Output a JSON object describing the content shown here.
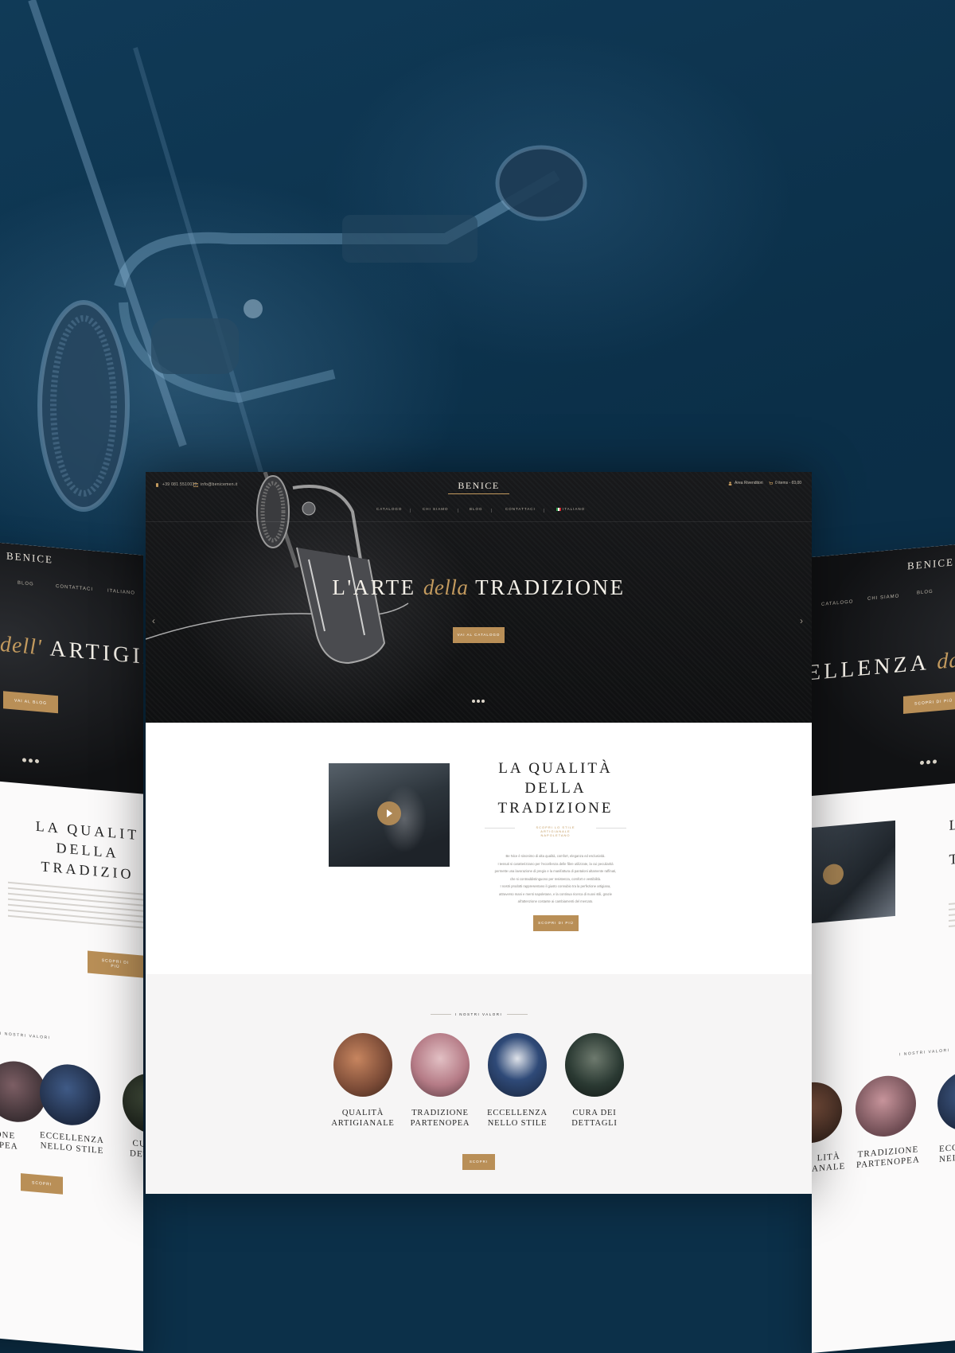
{
  "main": {
    "topbar": {
      "phone": "+39 081 5510033",
      "email": "info@benicemen.it",
      "logo": "BENICE",
      "reseller_area": "Area Rivenditori",
      "cart": "0 items - €0,00"
    },
    "nav": [
      "CATALOGO",
      "CHI SIAMO",
      "BLOG",
      "CONTATTACI",
      "ITALIANO"
    ],
    "hero": {
      "title_a": "L'ARTE",
      "title_b": "della",
      "title_c": "TRADIZIONE",
      "button": "VAI AL CATALOGO",
      "prev_arrow": "‹",
      "next_arrow": "›"
    },
    "quality": {
      "title": [
        "LA QUALITÀ",
        "DELLA",
        "TRADIZIONE"
      ],
      "subtitle": [
        "SCOPRI LO STILE",
        "ARTIGIANALE",
        "NAPOLETANO"
      ],
      "body": [
        "Be Nice è sinonimo di alta qualità, comfort, eleganza ed esclusività.",
        "I tessuti si caratterizzano per l'eccellenza delle fibre utilizzate, la cui peculiarità",
        "permette una lavorazione di pregio e la manifattura di pantaloni altamente raffinati,",
        "che si contraddistinguono per resistenza, comfort e vestibilità.",
        "I nostri prodotti rappresentano il giusto connubio tra la perfezione artigiana,",
        "attraverso mani e menti napoletane, e la continua ricerca di nuovi stili, grazie",
        "all'attenzione costante ai cambiamenti del mercato."
      ],
      "button": "SCOPRI DI PIÙ"
    },
    "values": {
      "label": "I NOSTRI VALORI",
      "items": [
        {
          "name": [
            "QUALITÀ",
            "ARTIGIANALE"
          ],
          "color": "#7a4a36"
        },
        {
          "name": [
            "TRADIZIONE",
            "PARTENOPEA"
          ],
          "color": "#b57b86"
        },
        {
          "name": [
            "ECCELLENZA",
            "NELLO STILE"
          ],
          "color": "#2f4a78"
        },
        {
          "name": [
            "CURA DEI",
            "DETTAGLI"
          ],
          "color": "#2b3a33"
        }
      ],
      "button": "SCOPRI"
    }
  },
  "left_mock": {
    "logo": "BENICE",
    "nav": [
      "BLOG",
      "CONTATTACI",
      "ITALIANO"
    ],
    "hero_title_a": "dell'",
    "hero_title_b": "ARTIGIA",
    "hero_button": "VAI AL BLOG",
    "heading": [
      "LA QUALIT",
      "DELLA",
      "TRADIZIO"
    ],
    "button": "SCOPRI DI PIÙ",
    "values_label": "I NOSTRI VALORI",
    "values": [
      [
        "ONE",
        "OPEA"
      ],
      [
        "ECCELLENZA",
        "NELLO STILE"
      ],
      [
        "CU",
        "DET"
      ]
    ],
    "bottom_button": "SCOPRI"
  },
  "right_mock": {
    "logo": "BENICE",
    "nav": [
      "CATALOGO",
      "CHI SIAMO",
      "BLOG"
    ],
    "hero_title_a": "ELLENZA",
    "hero_title_b": "da",
    "hero_button": "SCOPRI DI PIÙ",
    "heading": [
      "L",
      "T"
    ],
    "values_label": "I NOSTRI VALORI",
    "values": [
      [
        "LITÀ",
        "ANALE"
      ],
      [
        "TRADIZIONE",
        "PARTENOPEA"
      ],
      [
        "ECC",
        "NEL"
      ]
    ]
  },
  "colors": {
    "accent": "#b98f57",
    "background": "#0c3049",
    "hero_dark": "#121314"
  }
}
